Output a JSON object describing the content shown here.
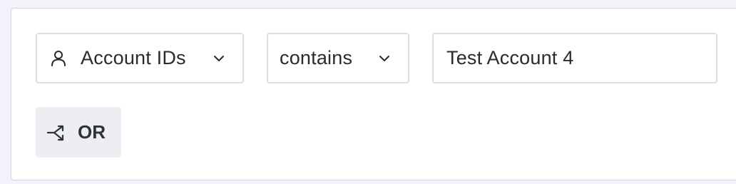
{
  "filter": {
    "field": {
      "label": "Account IDs",
      "icon": "person-icon"
    },
    "operator": {
      "label": "contains"
    },
    "value": {
      "text": "Test Account 4"
    }
  },
  "actions": {
    "or_label": "OR",
    "or_icon": "split-arrow-icon"
  },
  "colors": {
    "border": "#dedede",
    "button_bg": "#eceef1",
    "text": "#2b2b2b",
    "page_bg": "#f3f2fa"
  }
}
